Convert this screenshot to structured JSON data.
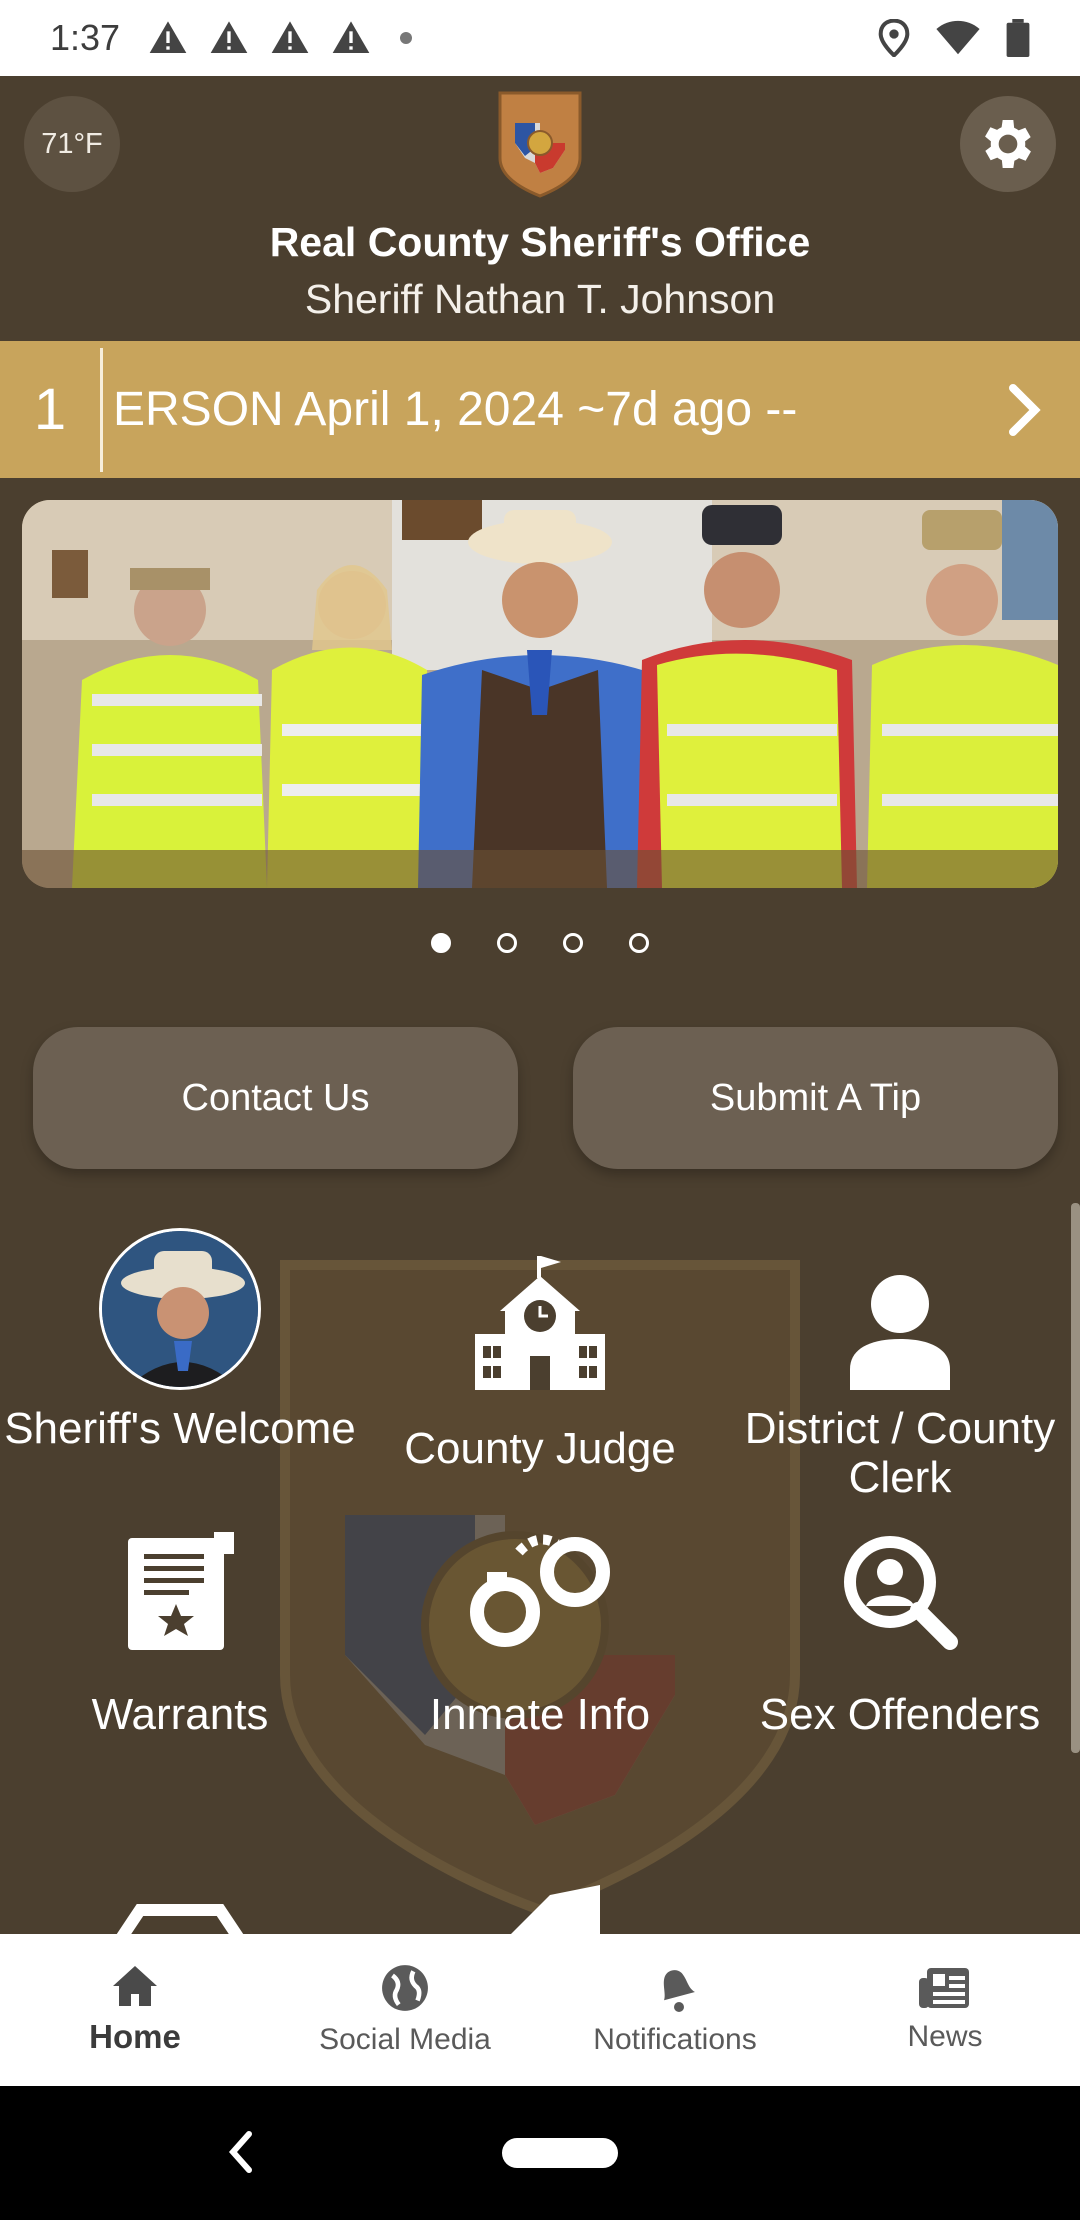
{
  "status_bar": {
    "time": "1:37",
    "warnings": 4
  },
  "header": {
    "temperature": "71°F",
    "title": "Real County Sheriff's Office",
    "subtitle": "Sheriff Nathan T. Johnson"
  },
  "ticker": {
    "number": "1",
    "text": "ERSON April 1, 2024 ~7d ago --"
  },
  "carousel": {
    "page_count": 4,
    "active_index": 0
  },
  "actions": {
    "contact": "Contact Us",
    "tip": "Submit A Tip"
  },
  "grid": {
    "items": [
      {
        "label": "Sheriff's Welcome",
        "icon": "sheriff-photo"
      },
      {
        "label": "County Judge",
        "icon": "schoolhouse-icon"
      },
      {
        "label": "District / County Clerk",
        "icon": "person-icon"
      },
      {
        "label": "Warrants",
        "icon": "warrant-document-icon"
      },
      {
        "label": "Inmate Info",
        "icon": "handcuffs-icon"
      },
      {
        "label": "Sex Offenders",
        "icon": "person-search-icon"
      }
    ]
  },
  "nav": {
    "items": [
      {
        "label": "Home",
        "icon": "home-icon"
      },
      {
        "label": "Social Media",
        "icon": "globe-icon"
      },
      {
        "label": "Notifications",
        "icon": "bell-icon"
      },
      {
        "label": "News",
        "icon": "newspaper-icon"
      }
    ],
    "active": 0
  },
  "colors": {
    "background": "#4b3f2f",
    "ticker": "#c8a45c",
    "button": "#6c6052"
  }
}
